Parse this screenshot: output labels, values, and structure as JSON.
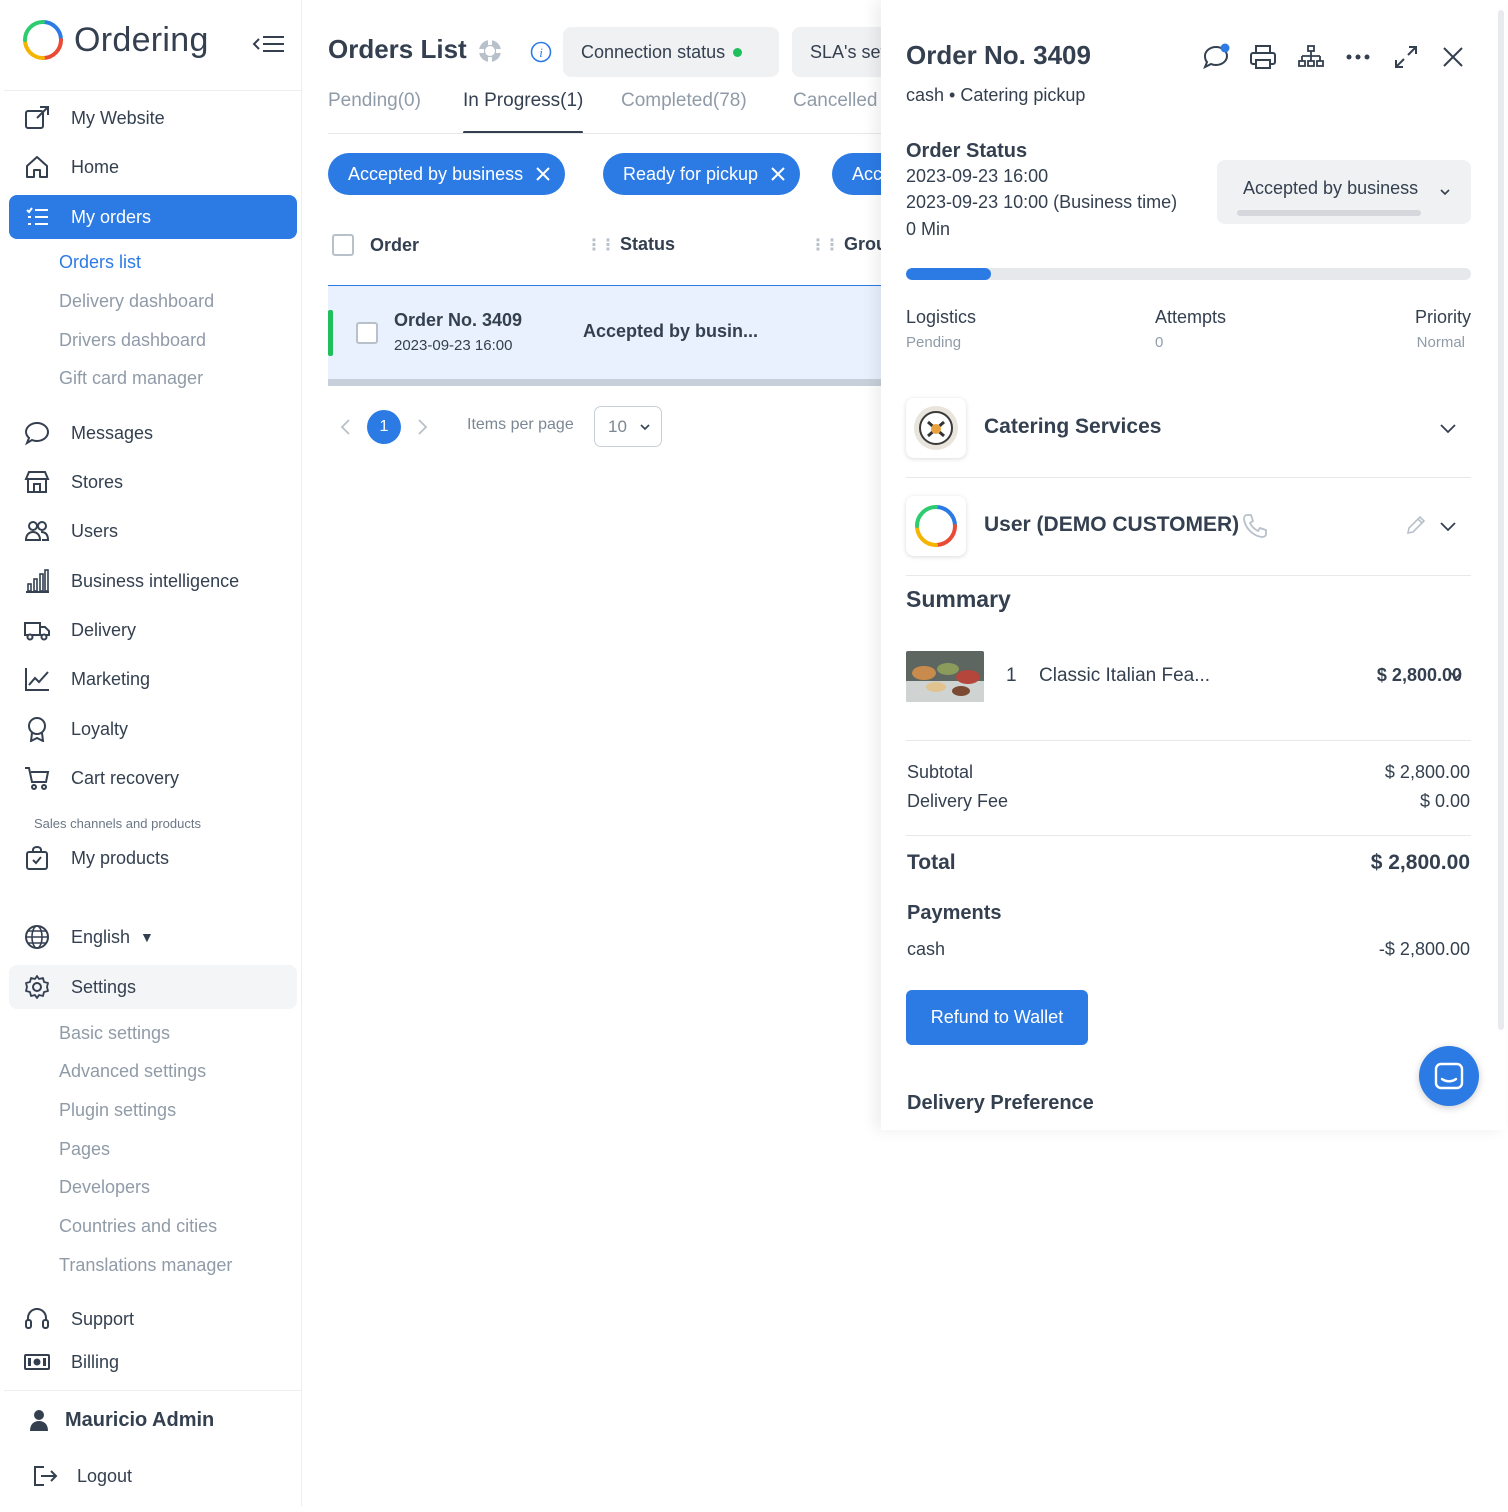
{
  "app": {
    "name": "Ordering"
  },
  "sidebar": {
    "top_items": [
      {
        "label": "My Website",
        "icon": "external-link-icon"
      },
      {
        "label": "Home",
        "icon": "home-icon"
      },
      {
        "label": "My orders",
        "icon": "list-icon"
      }
    ],
    "orders_sub": [
      "Orders list",
      "Delivery dashboard",
      "Drivers dashboard",
      "Gift card manager"
    ],
    "mid_items": [
      {
        "label": "Messages",
        "icon": "chat-bubble-icon"
      },
      {
        "label": "Stores",
        "icon": "store-icon"
      },
      {
        "label": "Users",
        "icon": "users-icon"
      },
      {
        "label": "Business intelligence",
        "icon": "bar-chart-icon"
      },
      {
        "label": "Delivery",
        "icon": "truck-icon"
      },
      {
        "label": "Marketing",
        "icon": "line-chart-icon"
      },
      {
        "label": "Loyalty",
        "icon": "award-icon"
      },
      {
        "label": "Cart recovery",
        "icon": "cart-icon"
      }
    ],
    "section_label": "Sales channels and products",
    "products_label": "My products",
    "language_label": "English",
    "settings_label": "Settings",
    "settings_sub": [
      "Basic settings",
      "Advanced settings",
      "Plugin settings",
      "Pages",
      "Developers",
      "Countries and cities",
      "Translations manager"
    ],
    "support_label": "Support",
    "billing_label": "Billing",
    "user_name": "Mauricio Admin",
    "logout_label": "Logout"
  },
  "main": {
    "title": "Orders List",
    "connection_status": "Connection status",
    "sla_label": "SLA's settings",
    "tabs": [
      {
        "label": "Pending(0)"
      },
      {
        "label": "In Progress(1)"
      },
      {
        "label": "Completed(78)"
      },
      {
        "label": "Cancelled"
      }
    ],
    "chips": [
      "Accepted by business",
      "Ready for pickup",
      "Accepted"
    ],
    "columns": {
      "order": "Order",
      "status": "Status",
      "group": "Group"
    },
    "row": {
      "order": "Order No. 3409",
      "date": "2023-09-23 16:00",
      "status": "Accepted by busin..."
    },
    "pagination": {
      "current": "1",
      "items_per_page_label": "Items per page",
      "items_per_page": "10"
    }
  },
  "detail": {
    "order_no": "Order No. 3409",
    "subtitle": "cash • Catering pickup",
    "status_title": "Order Status",
    "status_lines": [
      "2023-09-23 16:00",
      "2023-09-23 10:00 (Business time)",
      "0 Min"
    ],
    "status_select": "Accepted by business",
    "progress_fraction": 0.15,
    "logistics_label": "Logistics",
    "logistics_value": "Pending",
    "attempts_label": "Attempts",
    "attempts_value": "0",
    "priority_label": "Priority",
    "priority_value": "Normal",
    "business_name": "Catering Services",
    "customer_name": "User (DEMO CUSTOMER)",
    "summary_title": "Summary",
    "item": {
      "qty": "1",
      "name": "Classic Italian Fea...",
      "price": "$ 2,800.00"
    },
    "subtotal_label": "Subtotal",
    "subtotal_value": "$ 2,800.00",
    "delivery_fee_label": "Delivery Fee",
    "delivery_fee_value": "$ 0.00",
    "total_label": "Total",
    "total_value": "$ 2,800.00",
    "payments_title": "Payments",
    "payment_method": "cash",
    "payment_value": "-$ 2,800.00",
    "refund_label": "Refund to Wallet",
    "delivery_pref_title": "Delivery Preference"
  },
  "colors": {
    "accent": "#2c7be5",
    "success": "#1fbf5c",
    "text": "#344050",
    "muted": "#909ba8"
  }
}
